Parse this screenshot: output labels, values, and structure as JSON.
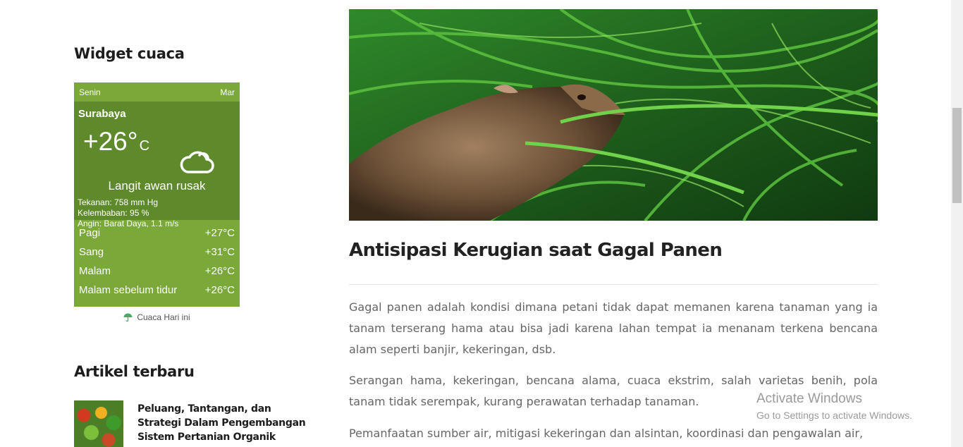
{
  "sidebar": {
    "weather_widget_title": "Widget cuaca",
    "articles_widget_title": "Artikel terbaru"
  },
  "weather": {
    "day_today": "Senin",
    "day_next": "Mar",
    "city": "Surabaya",
    "temperature": "+26°",
    "unit": "C",
    "condition_icon": "cloud-icon",
    "description": "Langit awan rusak",
    "pressure": "Tekanan: 758 mm Hg",
    "humidity": "Kelembaban: 95 %",
    "wind": "Angin: Barat Daya, 1.1 m/s",
    "forecast": [
      {
        "label": "Pagi",
        "temp": "+27°C"
      },
      {
        "label": "Sang",
        "temp": "+31°C"
      },
      {
        "label": "Malam",
        "temp": "+26°C"
      },
      {
        "label": "Malam sebelum tidur",
        "temp": "+26°C"
      }
    ],
    "footer": "Cuaca Hari ini",
    "colors": {
      "header": "#7aa93a",
      "main": "#5f8a2c"
    }
  },
  "articles": [
    {
      "title": "Peluang, Tantangan, dan Strategi Dalam Pengembangan Sistem Pertanian Organik"
    }
  ],
  "post": {
    "title": "Antisipasi Kerugian saat Gagal Panen",
    "paragraphs": [
      "Gagal panen adalah kondisi dimana petani tidak dapat memanen karena tanaman yang ia tanam terserang hama atau bisa jadi karena lahan tempat ia menanam terkena bencana alam seperti banjir, kekeringan, dsb.",
      "Serangan hama, kekeringan, bencana alama, cuaca ekstrim, salah varietas benih, pola tanam tidak serempak, kurang perawatan terhadap tanaman.",
      "Pemanfaatan sumber air, mitigasi kekeringan dan alsintan, koordinasi dan pengawalan air,"
    ]
  },
  "watermark": {
    "title": "Activate Windows",
    "subtitle": "Go to Settings to activate Windows."
  }
}
